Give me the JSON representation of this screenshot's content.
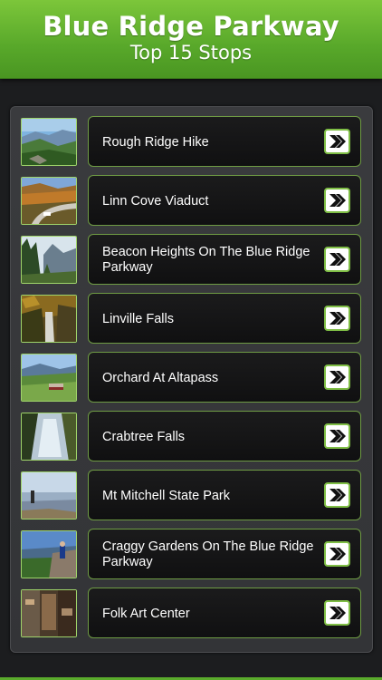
{
  "header": {
    "title": "Blue Ridge Parkway",
    "subtitle": "Top 15 Stops"
  },
  "colors": {
    "accent": "#5aab2c",
    "background": "#1c1d1f",
    "card": "#141415"
  },
  "stops": [
    {
      "label": "Rough Ridge Hike",
      "thumb": "mountain-ridge-thumbnail"
    },
    {
      "label": "Linn Cove Viaduct",
      "thumb": "viaduct-road-thumbnail"
    },
    {
      "label": "Beacon Heights On The Blue Ridge Parkway",
      "thumb": "forest-peaks-thumbnail"
    },
    {
      "label": "Linville Falls",
      "thumb": "waterfall-gorge-thumbnail"
    },
    {
      "label": "Orchard At Altapass",
      "thumb": "orchard-valley-thumbnail"
    },
    {
      "label": "Crabtree Falls",
      "thumb": "cascade-falls-thumbnail"
    },
    {
      "label": "Mt Mitchell State Park",
      "thumb": "summit-view-thumbnail"
    },
    {
      "label": "Craggy Gardens On The Blue Ridge Parkway",
      "thumb": "overlook-thumbnail"
    },
    {
      "label": "Folk Art Center",
      "thumb": "craft-interior-thumbnail"
    }
  ]
}
